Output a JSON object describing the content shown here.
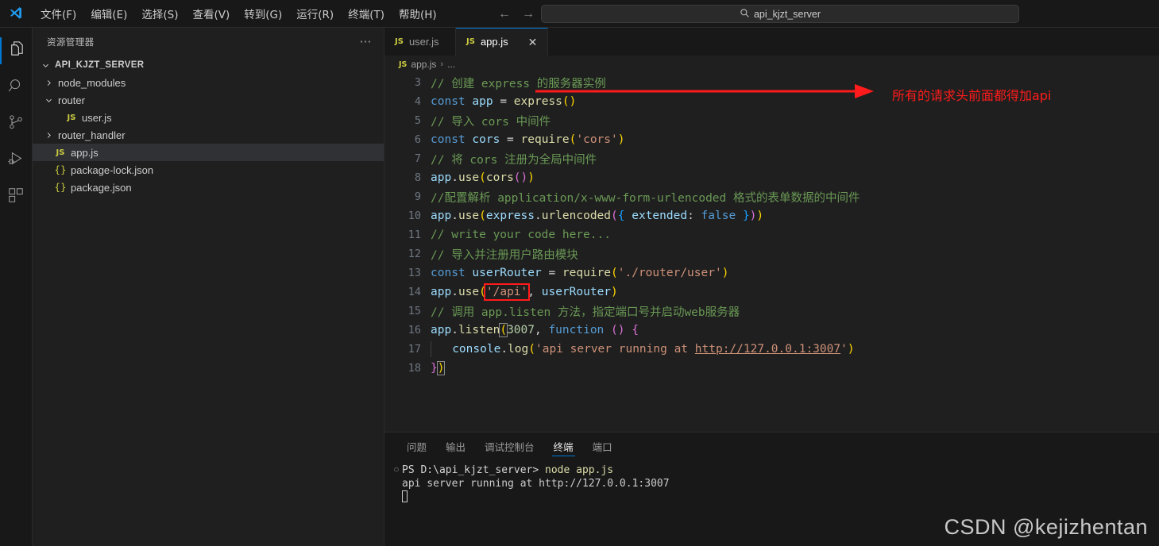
{
  "titlebar": {
    "logo_icon": "vscode-logo",
    "menus": [
      "文件(F)",
      "编辑(E)",
      "选择(S)",
      "查看(V)",
      "转到(G)",
      "运行(R)",
      "终端(T)",
      "帮助(H)"
    ],
    "nav_back_icon": "←",
    "nav_forward_icon": "→",
    "search_icon": "search-icon",
    "search_value": "api_kjzt_server"
  },
  "activitybar": {
    "items": [
      {
        "name": "explorer",
        "icon": "files-icon",
        "active": true
      },
      {
        "name": "search",
        "icon": "search-icon",
        "active": false
      },
      {
        "name": "source-control",
        "icon": "source-control-icon",
        "active": false
      },
      {
        "name": "run-debug",
        "icon": "run-debug-icon",
        "active": false
      },
      {
        "name": "extensions",
        "icon": "extensions-icon",
        "active": false
      }
    ]
  },
  "sidebar": {
    "title": "资源管理器",
    "more_icon": "ellipsis-icon",
    "tree": [
      {
        "label": "API_KJZT_SERVER",
        "type": "root",
        "expanded": true,
        "indent": 0
      },
      {
        "label": "node_modules",
        "type": "folder",
        "expanded": false,
        "indent": 1
      },
      {
        "label": "router",
        "type": "folder",
        "expanded": true,
        "indent": 1
      },
      {
        "label": "user.js",
        "type": "js",
        "indent": 2
      },
      {
        "label": "router_handler",
        "type": "folder",
        "expanded": false,
        "indent": 1
      },
      {
        "label": "app.js",
        "type": "js",
        "indent": 1,
        "selected": true
      },
      {
        "label": "package-lock.json",
        "type": "json",
        "indent": 1
      },
      {
        "label": "package.json",
        "type": "json",
        "indent": 1
      }
    ],
    "icons": {
      "js": "JS",
      "json": "{}"
    }
  },
  "tabs": [
    {
      "label": "user.js",
      "icon": "JS",
      "active": false,
      "closable": false
    },
    {
      "label": "app.js",
      "icon": "JS",
      "active": true,
      "closable": true,
      "close_icon": "close-icon"
    }
  ],
  "breadcrumb": {
    "icon": "JS",
    "file": "app.js",
    "separator": "›",
    "tail": "..."
  },
  "code": {
    "first_line_number": 3,
    "lines": [
      {
        "n": 3,
        "text": "// 创建 express 的服务器实例"
      },
      {
        "n": 4,
        "text": "const app = express()"
      },
      {
        "n": 5,
        "text": "// 导入 cors 中间件"
      },
      {
        "n": 6,
        "text": "const cors = require('cors')"
      },
      {
        "n": 7,
        "text": "// 将 cors 注册为全局中间件"
      },
      {
        "n": 8,
        "text": "app.use(cors())"
      },
      {
        "n": 9,
        "text": "//配置解析 application/x-www-form-urlencoded 格式的表单数据的中间件"
      },
      {
        "n": 10,
        "text": "app.use(express.urlencoded({ extended: false }))"
      },
      {
        "n": 11,
        "text": "// write your code here..."
      },
      {
        "n": 12,
        "text": "// 导入并注册用户路由模块"
      },
      {
        "n": 13,
        "text": "const userRouter = require('./router/user')"
      },
      {
        "n": 14,
        "text": "app.use('/api', userRouter)"
      },
      {
        "n": 15,
        "text": "// 调用 app.listen 方法，指定端口号并启动web服务器"
      },
      {
        "n": 16,
        "text": "app.listen(3007, function () {"
      },
      {
        "n": 17,
        "text": "    console.log('api server running at http://127.0.0.1:3007')"
      },
      {
        "n": 18,
        "text": "})"
      }
    ]
  },
  "annotation": {
    "text": "所有的请求头前面都得加api",
    "color": "#ff1b1b",
    "highlight_target": "'/api'"
  },
  "panel": {
    "tabs": [
      {
        "label": "问题",
        "active": false
      },
      {
        "label": "输出",
        "active": false
      },
      {
        "label": "调试控制台",
        "active": false
      },
      {
        "label": "终端",
        "active": true
      },
      {
        "label": "端口",
        "active": false
      }
    ],
    "terminal": {
      "prompt": "PS D:\\api_kjzt_server>",
      "command": "node app.js",
      "output": "api server running at http://127.0.0.1:3007",
      "bullet_icon": "circle-icon",
      "cursor_icon": "cursor-block"
    }
  },
  "watermark": "CSDN @kejizhentan",
  "colors": {
    "accent": "#0078d4",
    "annotation_red": "#ff1b1b",
    "editor_bg": "#1f1f1f",
    "chrome_bg": "#181818"
  }
}
